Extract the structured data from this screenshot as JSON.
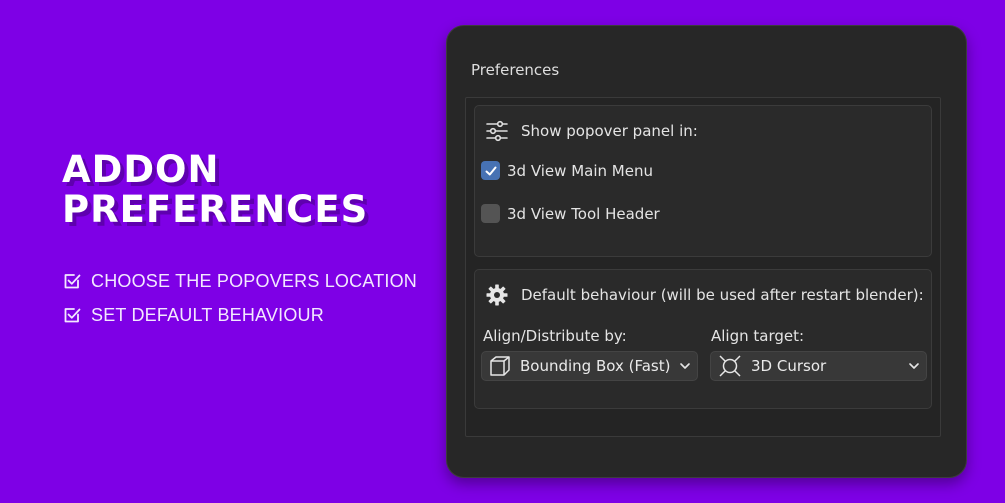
{
  "promo": {
    "title_line1": "ADDON",
    "title_line2": "PREFERENCES",
    "features": [
      "CHOOSE THE POPOVERS LOCATION",
      "SET DEFAULT BEHAVIOUR"
    ]
  },
  "window": {
    "title": "Preferences",
    "popover_section": {
      "heading": "Show popover panel in:",
      "icon": "sliders-icon",
      "options": [
        {
          "label": "3d View Main Menu",
          "checked": true
        },
        {
          "label": "3d View Tool Header",
          "checked": false
        }
      ]
    },
    "behaviour_section": {
      "heading": "Default behaviour (will be used after restart blender):",
      "icon": "gear-icon",
      "align_by": {
        "label": "Align/Distribute by:",
        "value": "Bounding Box (Fast)",
        "icon": "cube-icon"
      },
      "align_target": {
        "label": "Align target:",
        "value": "3D Cursor",
        "icon": "cursor-3d-icon"
      }
    }
  },
  "colors": {
    "background": "#7e00e6",
    "panel": "#272727",
    "checkbox_checked": "#4772b3",
    "checkbox_unchecked": "#545454"
  }
}
